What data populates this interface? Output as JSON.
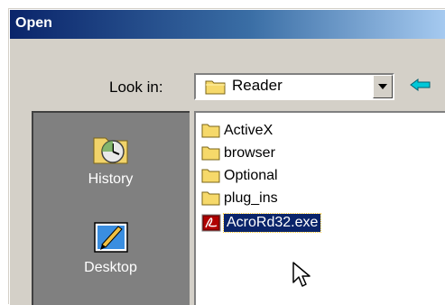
{
  "window": {
    "title": "Open"
  },
  "lookin": {
    "label": "Look in:",
    "value": "Reader"
  },
  "places": [
    {
      "label": "History",
      "icon": "history-icon"
    },
    {
      "label": "Desktop",
      "icon": "desktop-icon"
    }
  ],
  "files": [
    {
      "name": "ActiveX",
      "type": "folder"
    },
    {
      "name": "browser",
      "type": "folder"
    },
    {
      "name": "Optional",
      "type": "folder"
    },
    {
      "name": "plug_ins",
      "type": "folder"
    },
    {
      "name": "AcroRd32.exe",
      "type": "exe",
      "selected": true
    }
  ],
  "colors": {
    "title_bar_start": "#0a246a",
    "title_bar_end": "#a6caf0",
    "dialog_face": "#d4d0c8",
    "places_bar": "#808080",
    "selection": "#0a246a",
    "back_arrow": "#00a0b0"
  }
}
